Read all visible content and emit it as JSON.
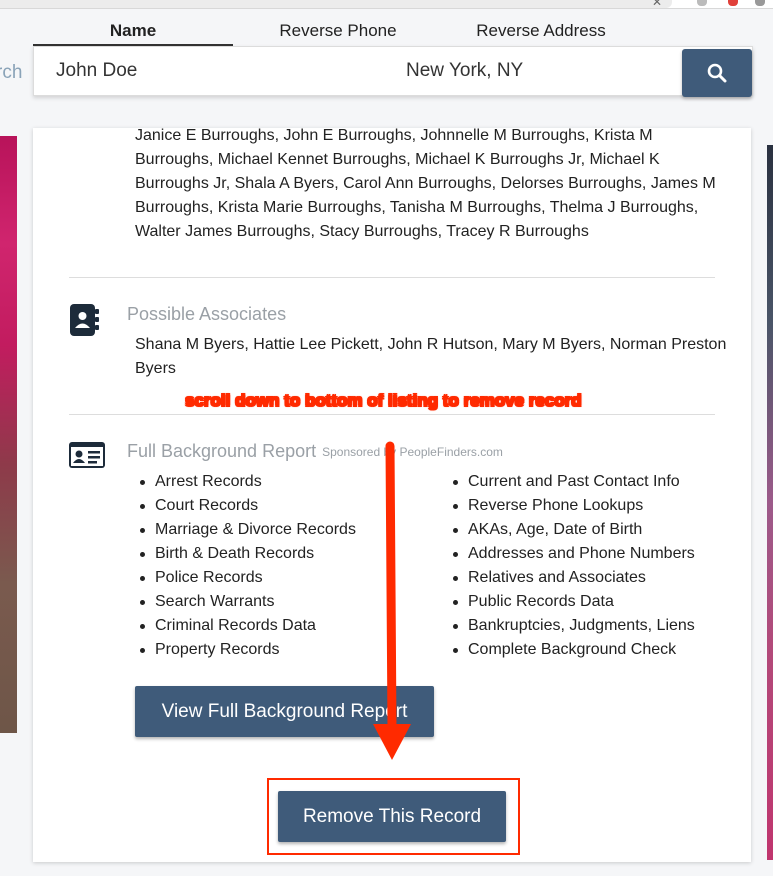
{
  "tabs": [
    {
      "label": "Name",
      "active": true
    },
    {
      "label": "Reverse Phone",
      "active": false
    },
    {
      "label": "Reverse Address",
      "active": false
    }
  ],
  "search": {
    "name_value": "John Doe",
    "location_value": "New York, NY",
    "side_text": "rch",
    "button_icon": "search-icon"
  },
  "relatives": {
    "text": "Janice E Burroughs, John E Burroughs, Johnnelle M Burroughs, Krista M Burroughs, Michael Kennet Burroughs, Michael K Burroughs Jr, Michael K Burroughs Jr, Shala A Byers, Carol Ann Burroughs, Delorses Burroughs, James M Burroughs, Krista Marie Burroughs, Tanisha M Burroughs, Thelma J Burroughs, Walter James Burroughs, Stacy Burroughs, Tracey R Burroughs"
  },
  "associates": {
    "title": "Possible Associates",
    "icon": "address-book-icon",
    "text": "Shana M Byers, Hattie Lee Pickett, John R Hutson, Mary M Byers, Norman Preston Byers"
  },
  "annotation": {
    "text": "scroll down to bottom of listing to remove record",
    "color": "#ff2a00"
  },
  "background_report": {
    "title": "Full Background Report",
    "sponsored": "Sponsored by PeopleFinders.com",
    "icon": "id-card-icon",
    "features_left": [
      "Arrest Records",
      "Court Records",
      "Marriage & Divorce Records",
      "Birth & Death Records",
      "Police Records",
      "Search Warrants",
      "Criminal Records Data",
      "Property Records"
    ],
    "features_right": [
      "Current and Past Contact Info",
      "Reverse Phone Lookups",
      "AKAs, Age, Date of Birth",
      "Addresses and Phone Numbers",
      "Relatives and Associates",
      "Public Records Data",
      "Bankruptcies, Judgments, Liens",
      "Complete Background Check"
    ],
    "button_label": "View Full Background Report"
  },
  "remove": {
    "button_label": "Remove This Record"
  },
  "colors": {
    "primary_button": "#3f5b7a",
    "annotation_red": "#ff2a00",
    "muted_title": "#9aa0a6"
  }
}
